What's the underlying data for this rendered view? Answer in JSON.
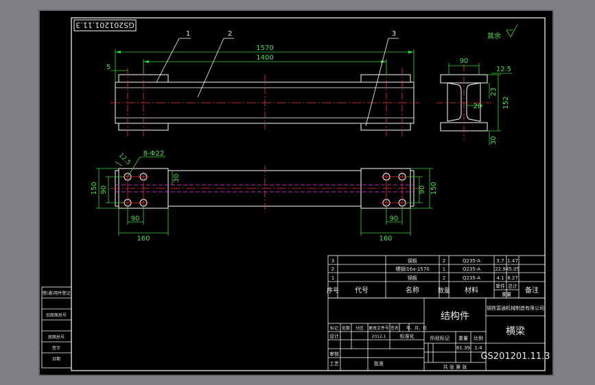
{
  "colors": {
    "background": "#000000",
    "outline": "#ffffff",
    "dimension": "#33dd33",
    "centerline": "#ff3333",
    "hidden": "#ff33ff",
    "frame_margin": "#7f7f86"
  },
  "stamp": {
    "code": "GS201201.11.3"
  },
  "leaders": {
    "one": "1",
    "two": "2",
    "three": "3"
  },
  "front_view": {
    "dim_overall": "1570",
    "dim_holes": "1400",
    "dim_end": "5"
  },
  "section_view": {
    "dim_width": "90",
    "dim_flange": "12.5",
    "dim_web": "20",
    "dim_offset": "23",
    "dim_height": "152",
    "dim_foot": "30",
    "roughness": "其余"
  },
  "plan_view": {
    "dim_left_height": "150",
    "dim_left_inner": "90",
    "dim_left_pitch": "90",
    "dim_left_plate": "160",
    "dim_beam": "30",
    "dim_right_pitch": "90",
    "dim_right_plate": "160",
    "dim_right_inner": "90",
    "dim_right_height": "150",
    "hole_callout": "8-Φ22",
    "chamfer": "12.5"
  },
  "bom": {
    "rows": [
      {
        "no": "3",
        "name": "钢板",
        "qty": "2",
        "material": "Q235-A",
        "unit": "3.7",
        "total": "1.47"
      },
      {
        "no": "2",
        "name": "槽钢I16a-1570",
        "qty": "1",
        "material": "Q235-A",
        "unit": "22.9",
        "total": "45.05"
      },
      {
        "no": "1",
        "name": "钢板",
        "qty": "2",
        "material": "Q235-A",
        "unit": "4.1",
        "total": "8.27"
      }
    ],
    "header": {
      "no": "序号",
      "code": "代号",
      "name": "名称",
      "qty": "数量",
      "material": "材料",
      "unit_label": "单件",
      "total_label": "总计",
      "weight": "重量",
      "remark": "备注"
    }
  },
  "title_block": {
    "drawing_name": "结构件",
    "company": "钢铁富通机械制造有限公司",
    "part_name": "横梁",
    "drawing_no": "GS201201.11.3",
    "stage_label": "阶段标记",
    "weight_label": "重量",
    "scale_label": "比例",
    "weight": "61.39",
    "scale": "1:4",
    "sheet_label": "共  张  第  张",
    "rev_headers": [
      "标记",
      "处数",
      "分区",
      "更改文件号",
      "签名",
      "年、月、日"
    ],
    "design": "设计",
    "design_date": "2012.1",
    "standard": "标准化",
    "review": "审核",
    "process": "工艺",
    "approve": "批准"
  },
  "side_table": {
    "rows": [
      "借(通)用件登记",
      "旧底图总号",
      "底图总号",
      "签字",
      "日期"
    ]
  }
}
